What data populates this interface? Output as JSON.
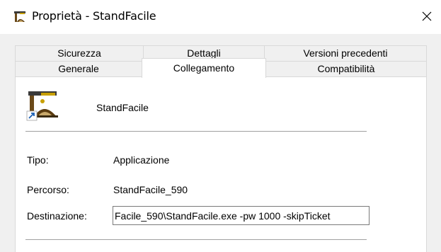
{
  "window": {
    "title": "Proprietà - StandFacile",
    "app_icon": "standfacile-app-icon",
    "close_icon": "close-icon"
  },
  "tabs": {
    "back_row": [
      {
        "label": "Sicurezza"
      },
      {
        "label": "Dettagli"
      },
      {
        "label": "Versioni precedenti"
      }
    ],
    "front_row": [
      {
        "label": "Generale"
      },
      {
        "label": "Collegamento",
        "selected": true
      },
      {
        "label": "Compatibilità"
      }
    ]
  },
  "shortcut": {
    "name": "StandFacile",
    "icon": "standfacile-shortcut-icon",
    "fields": {
      "tipo_label": "Tipo:",
      "tipo_value": "Applicazione",
      "percorso_label": "Percorso:",
      "percorso_value": "StandFacile_590",
      "destinazione_label": "Destinazione:",
      "destinazione_value": "Facile_590\\StandFacile.exe -pw 1000 -skipTicket"
    }
  },
  "colors": {
    "window_bg": "#f0f0f0",
    "panel_bg": "#ffffff",
    "border": "#d9d9d9",
    "separator": "#a0a0a0",
    "input_border": "#7a7a7a"
  }
}
